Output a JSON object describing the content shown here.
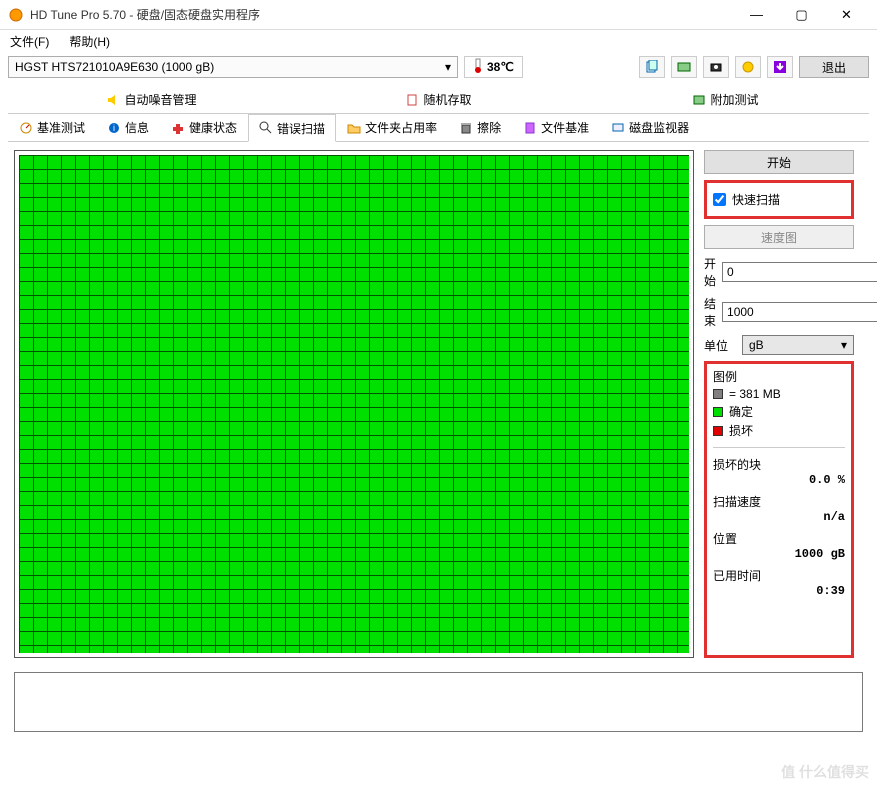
{
  "window": {
    "title": "HD Tune Pro 5.70 - 硬盘/固态硬盘实用程序"
  },
  "menu": {
    "file": "文件(F)",
    "help": "帮助(H)"
  },
  "toolbar": {
    "drive": "HGST HTS721010A9E630 (1000 gB)",
    "temp": "38℃",
    "exit": "退出"
  },
  "tabs_top": {
    "noise": "自动噪音管理",
    "random": "随机存取",
    "extra": "附加测试"
  },
  "tabs_bottom": {
    "benchmark": "基准测试",
    "info": "信息",
    "health": "健康状态",
    "error": "错误扫描",
    "folder": "文件夹占用率",
    "erase": "擦除",
    "filebench": "文件基准",
    "monitor": "磁盘监视器"
  },
  "side": {
    "start": "开始",
    "quick_scan": "快速扫描",
    "speed_map": "速度图",
    "start_label": "开始",
    "start_value": "0",
    "end_label": "结束",
    "end_value": "1000",
    "unit_label": "单位",
    "unit_value": "gB"
  },
  "legend": {
    "title": "图例",
    "block_size": "= 381 MB",
    "ok": "确定",
    "damaged": "损坏"
  },
  "stats": {
    "damaged_label": "损坏的块",
    "damaged_value": "0.0 %",
    "speed_label": "扫描速度",
    "speed_value": "n/a",
    "position_label": "位置",
    "position_value": "1000 gB",
    "elapsed_label": "已用时间",
    "elapsed_value": "0:39"
  },
  "watermark": "值 什么值得买",
  "chart_data": {
    "type": "heatmap",
    "title": "Error Scan Block Map",
    "block_size_mb": 381,
    "total_gb": 1000,
    "status": {
      "ok_percent": 100.0,
      "damaged_percent": 0.0
    },
    "colors": {
      "ok": "#00e000",
      "damaged": "#e00000",
      "untested": "#808080"
    }
  }
}
